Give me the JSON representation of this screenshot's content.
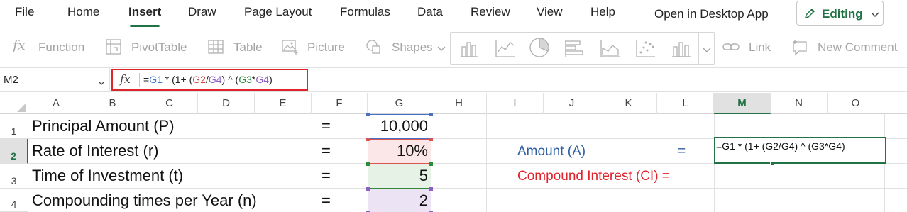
{
  "menu": {
    "items": [
      "File",
      "Home",
      "Insert",
      "Draw",
      "Page Layout",
      "Formulas",
      "Data",
      "Review",
      "View",
      "Help"
    ],
    "active": "Insert",
    "open_desktop": "Open in Desktop App",
    "editing": "Editing"
  },
  "ribbon": {
    "function": "Function",
    "pivottable": "PivotTable",
    "table": "Table",
    "picture": "Picture",
    "shapes": "Shapes",
    "link": "Link",
    "new_comment": "New Comment"
  },
  "formula_bar": {
    "name_box": "M2",
    "fx": "fx",
    "formula_parts": [
      "=",
      "G1",
      " * (1+ (",
      "G2",
      "/",
      "G4",
      ") ^ (",
      "G3",
      "*",
      "G4",
      ")"
    ]
  },
  "columns": [
    "A",
    "B",
    "C",
    "D",
    "E",
    "F",
    "G",
    "H",
    "I",
    "J",
    "K",
    "L",
    "M",
    "N",
    "O"
  ],
  "rows": [
    "1",
    "2",
    "3",
    "4"
  ],
  "cells": {
    "a1": "Principal Amount (P)",
    "a2": "Rate of Interest (r)",
    "a3": "Time of Investment (t)",
    "a4": "Compounding times per Year (n)",
    "eq": "=",
    "g1": "10,000",
    "g2": "10%",
    "g3": "5",
    "g4": "2",
    "amount_label": "Amount (A)",
    "amount_eq": "=",
    "ci_label": "Compound Interest (CI) =",
    "m2": "=G1 * (1+ (G2/G4) ^ (G3*G4)"
  },
  "colors": {
    "accent": "#217346",
    "ref_g1": "#4472c4",
    "ref_g2": "#d9534f",
    "ref_g3": "#2f8a3c",
    "ref_g4": "#8b5fc4",
    "amount_label": "#2e5fa3",
    "ci_label": "#e0242c"
  }
}
